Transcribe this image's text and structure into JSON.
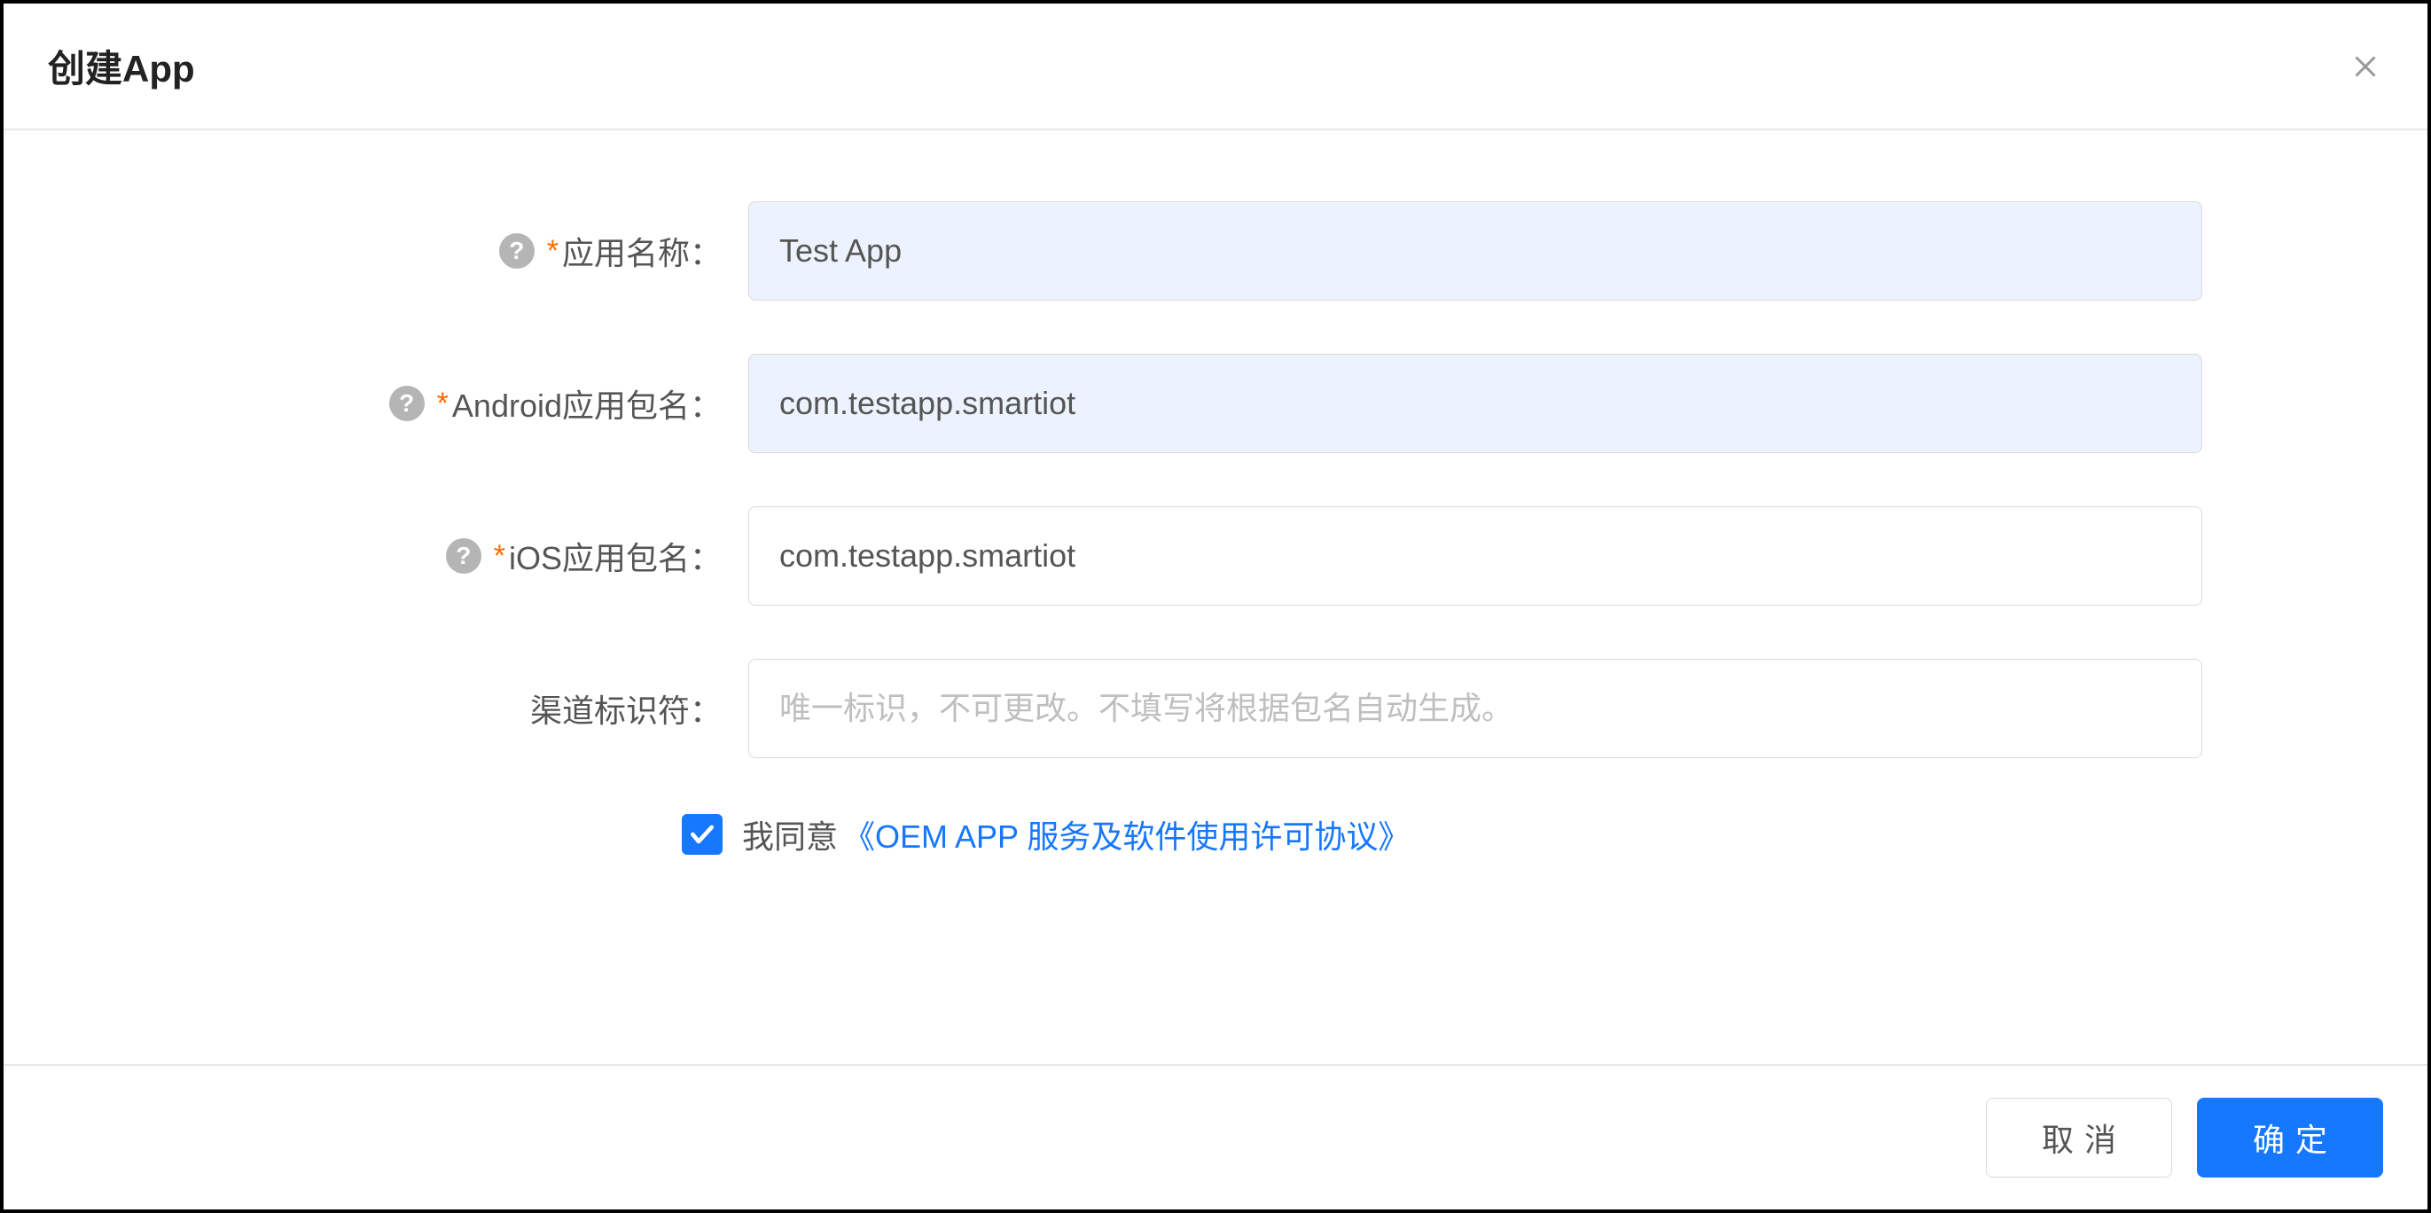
{
  "modal": {
    "title": "创建App"
  },
  "form": {
    "app_name": {
      "label": "应用名称：",
      "value": "Test App",
      "required": true,
      "has_help": true
    },
    "android_package": {
      "label": "Android应用包名：",
      "value": "com.testapp.smartiot",
      "required": true,
      "has_help": true
    },
    "ios_package": {
      "label": "iOS应用包名：",
      "value": "com.testapp.smartiot",
      "required": true,
      "has_help": true
    },
    "channel_id": {
      "label": "渠道标识符：",
      "placeholder": "唯一标识，不可更改。不填写将根据包名自动生成。",
      "required": false,
      "has_help": false
    }
  },
  "agreement": {
    "checked": true,
    "prefix_text": "我同意",
    "link_text": "《OEM APP 服务及软件使用许可协议》"
  },
  "footer": {
    "cancel_label": "取消",
    "confirm_label": "确定"
  },
  "required_mark": "*"
}
